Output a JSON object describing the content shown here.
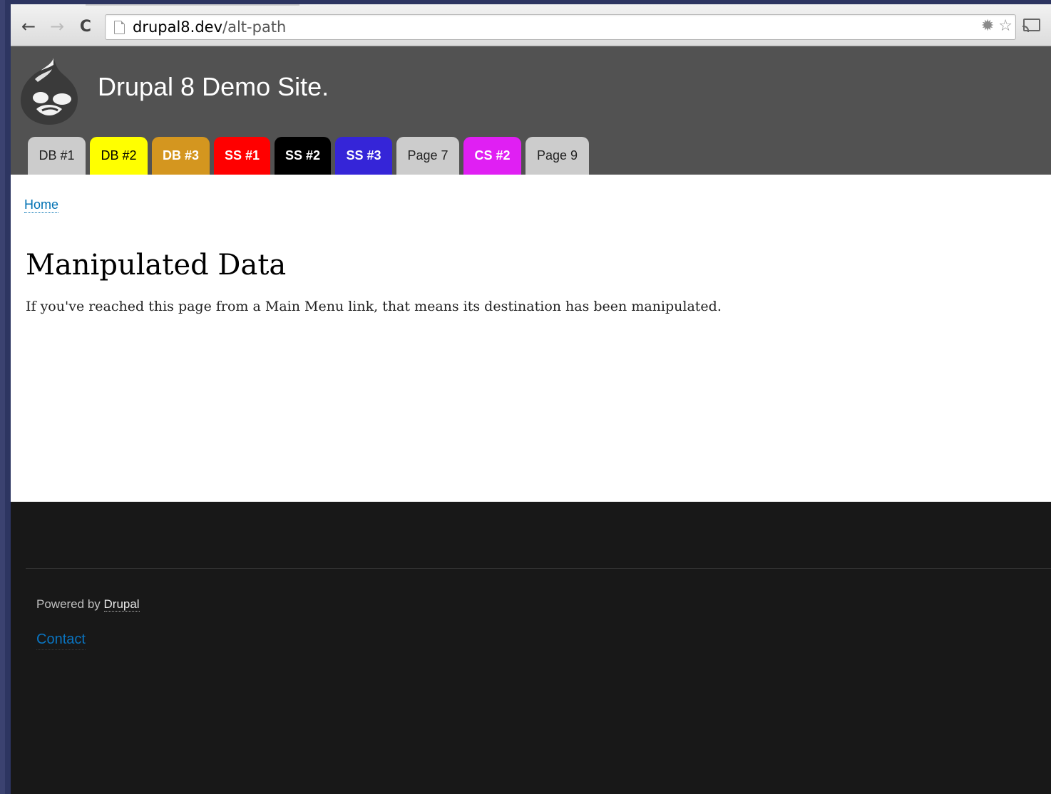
{
  "browser": {
    "url_host": "drupal8.dev",
    "url_path": "/alt-path",
    "back_icon": "←",
    "forward_icon": "→",
    "reload_icon": "C",
    "extension_icon": "✹",
    "star_icon": "☆"
  },
  "header": {
    "site_name": "Drupal 8 Demo Site."
  },
  "menu": {
    "items": [
      {
        "label": "DB #1",
        "bg": "#cccccc",
        "color": "#222222"
      },
      {
        "label": "DB #2",
        "bg": "#ffff00",
        "color": "#000000"
      },
      {
        "label": "DB #3",
        "bg": "#d4961f",
        "color": "#ffffff"
      },
      {
        "label": "SS #1",
        "bg": "#ff0000",
        "color": "#ffffff"
      },
      {
        "label": "SS #2",
        "bg": "#000000",
        "color": "#ffffff"
      },
      {
        "label": "SS #3",
        "bg": "#3525d8",
        "color": "#ffffff"
      },
      {
        "label": "Page 7",
        "bg": "#cccccc",
        "color": "#222222"
      },
      {
        "label": "CS #2",
        "bg": "#e01ff3",
        "color": "#ffffff"
      },
      {
        "label": "Page 9",
        "bg": "#cccccc",
        "color": "#222222"
      }
    ]
  },
  "content": {
    "breadcrumb_home": "Home",
    "title": "Manipulated Data",
    "body": "If you've reached this page from a Main Menu link, that means its destination has been manipulated."
  },
  "footer": {
    "powered_prefix": "Powered by ",
    "powered_link": "Drupal",
    "contact": "Contact"
  }
}
